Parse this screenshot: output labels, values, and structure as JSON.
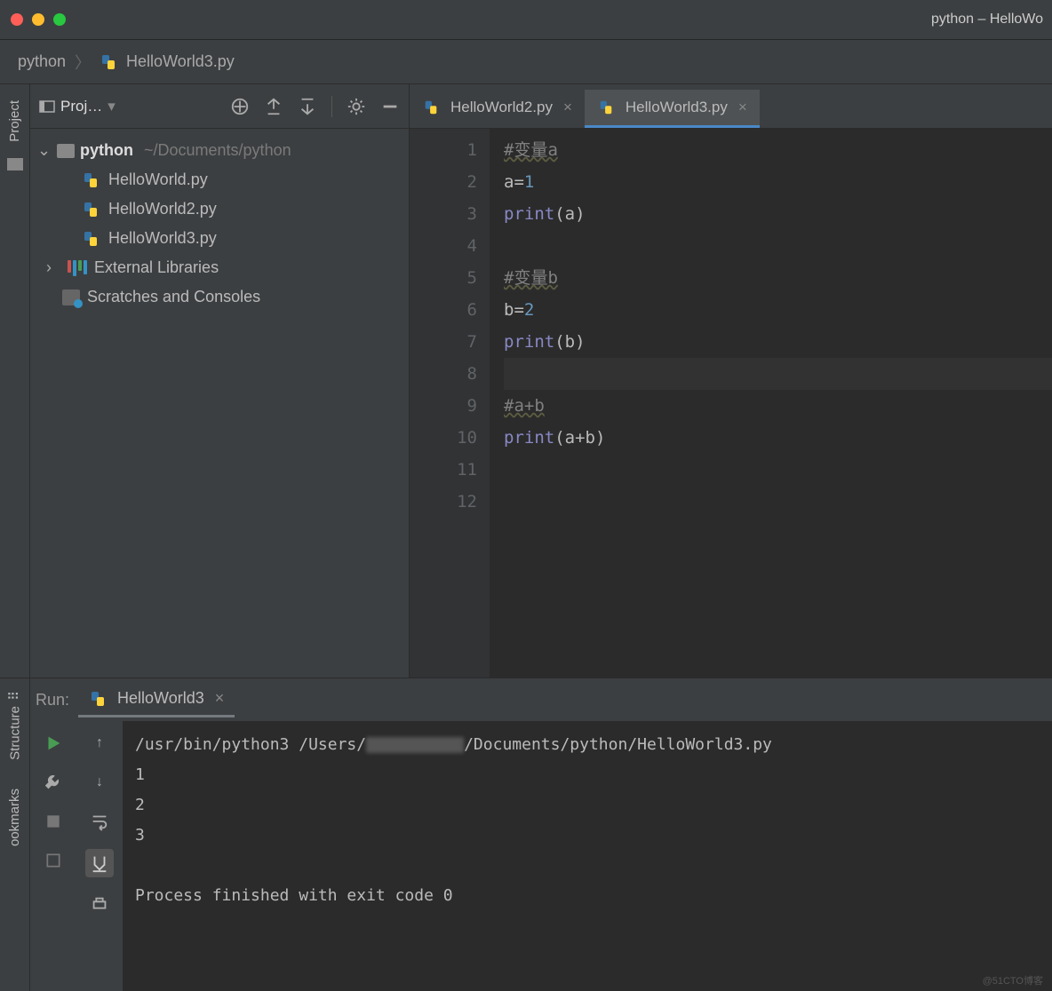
{
  "titlebar": {
    "title": "python – HelloWo"
  },
  "breadcrumb": {
    "root": "python",
    "file": "HelloWorld3.py"
  },
  "sidebar": {
    "title": "Proj…",
    "project": {
      "name": "python",
      "path": "~/Documents/python"
    },
    "files": [
      "HelloWorld.py",
      "HelloWorld2.py",
      "HelloWorld3.py"
    ],
    "external_libraries": "External Libraries",
    "scratches": "Scratches and Consoles"
  },
  "left_gutter": {
    "project": "Project"
  },
  "tabs": [
    {
      "label": "HelloWorld2.py",
      "active": false
    },
    {
      "label": "HelloWorld3.py",
      "active": true
    }
  ],
  "code": {
    "lines": [
      {
        "n": 1,
        "type": "comment",
        "text": "#变量a"
      },
      {
        "n": 2,
        "type": "assign",
        "lhs": "a",
        "rhs": "1"
      },
      {
        "n": 3,
        "type": "print",
        "arg": "a"
      },
      {
        "n": 4,
        "type": "blank"
      },
      {
        "n": 5,
        "type": "comment",
        "text": "#变量b"
      },
      {
        "n": 6,
        "type": "assign",
        "lhs": "b",
        "rhs": "2"
      },
      {
        "n": 7,
        "type": "print",
        "arg": "b"
      },
      {
        "n": 8,
        "type": "blank",
        "current": true
      },
      {
        "n": 9,
        "type": "comment",
        "text": "#a+b"
      },
      {
        "n": 10,
        "type": "print",
        "arg": "a+b"
      },
      {
        "n": 11,
        "type": "blank"
      },
      {
        "n": 12,
        "type": "blank"
      }
    ]
  },
  "run": {
    "label": "Run:",
    "config": "HelloWorld3",
    "output": {
      "cmd_pre": "/usr/bin/python3 /Users/",
      "cmd_post": "/Documents/python/HelloWorld3.py",
      "lines": [
        "1",
        "2",
        "3"
      ],
      "finish": "Process finished with exit code 0"
    }
  },
  "lower_gutter": {
    "structure": "Structure",
    "bookmarks": "ookmarks"
  },
  "watermark": "@51CTO博客"
}
